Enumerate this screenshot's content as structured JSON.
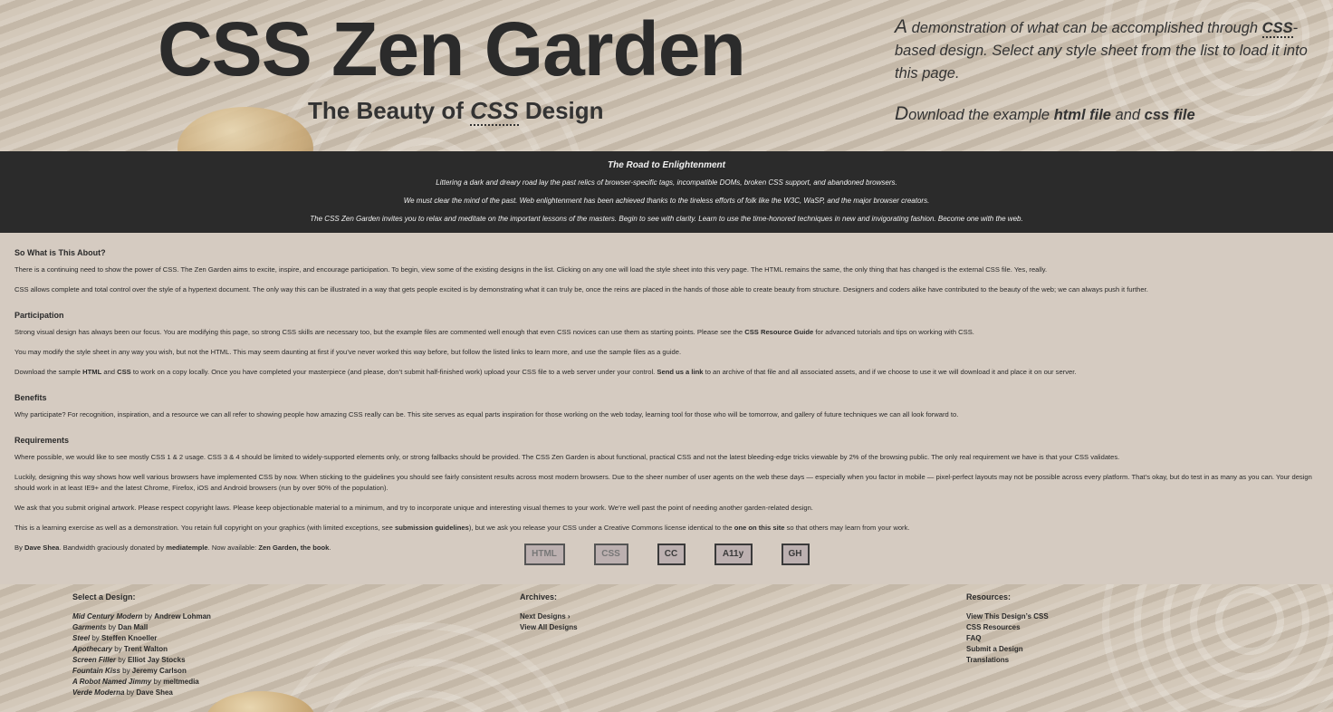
{
  "header": {
    "title": "CSS Zen Garden",
    "tagline_prefix": "The Beauty of ",
    "tagline_abbr": "CSS",
    "tagline_suffix": " Design"
  },
  "summary": {
    "p1_cap": "A",
    "p1_a": " demonstration of what can be accomplished through ",
    "p1_abbr": "CSS",
    "p1_b": "-based design. Select any style sheet from the list to load it into this page.",
    "p2_cap": "D",
    "p2_a": "ownload the example ",
    "p2_html_link": "html file",
    "p2_and": " and ",
    "p2_css_link": "css file"
  },
  "preamble": {
    "heading": "The Road to Enlightenment",
    "p1": "Littering a dark and dreary road lay the past relics of browser-specific tags, incompatible DOMs, broken CSS support, and abandoned browsers.",
    "p2": "We must clear the mind of the past. Web enlightenment has been achieved thanks to the tireless efforts of folk like the W3C, WaSP, and the major browser creators.",
    "p3": "The CSS Zen Garden invites you to relax and meditate on the important lessons of the masters. Begin to see with clarity. Learn to use the time-honored techniques in new and invigorating fashion. Become one with the web."
  },
  "explanation": {
    "heading": "So What is This About?",
    "p1": "There is a continuing need to show the power of CSS. The Zen Garden aims to excite, inspire, and encourage participation. To begin, view some of the existing designs in the list. Clicking on any one will load the style sheet into this very page. The HTML remains the same, the only thing that has changed is the external CSS file. Yes, really.",
    "p2": "CSS allows complete and total control over the style of a hypertext document. The only way this can be illustrated in a way that gets people excited is by demonstrating what it can truly be, once the reins are placed in the hands of those able to create beauty from structure. Designers and coders alike have contributed to the beauty of the web; we can always push it further."
  },
  "participation": {
    "heading": "Participation",
    "p1_a": "Strong visual design has always been our focus. You are modifying this page, so strong CSS skills are necessary too, but the example files are commented well enough that even CSS novices can use them as starting points. Please see the ",
    "p1_link": "CSS Resource Guide",
    "p1_b": " for advanced tutorials and tips on working with CSS.",
    "p2": "You may modify the style sheet in any way you wish, but not the HTML. This may seem daunting at first if you’ve never worked this way before, but follow the listed links to learn more, and use the sample files as a guide.",
    "p3_a": "Download the sample ",
    "p3_html": "HTML",
    "p3_and": " and ",
    "p3_css": "CSS",
    "p3_b": " to work on a copy locally. Once you have completed your masterpiece (and please, don’t submit half-finished work) upload your CSS file to a web server under your control. ",
    "p3_link": "Send us a link",
    "p3_c": " to an archive of that file and all associated assets, and if we choose to use it we will download it and place it on our server."
  },
  "benefits": {
    "heading": "Benefits",
    "p1": "Why participate? For recognition, inspiration, and a resource we can all refer to showing people how amazing CSS really can be. This site serves as equal parts inspiration for those working on the web today, learning tool for those who will be tomorrow, and gallery of future techniques we can all look forward to."
  },
  "requirements": {
    "heading": "Requirements",
    "p1": "Where possible, we would like to see mostly CSS 1 & 2 usage. CSS 3 & 4 should be limited to widely-supported elements only, or strong fallbacks should be provided. The CSS Zen Garden is about functional, practical CSS and not the latest bleeding-edge tricks viewable by 2% of the browsing public. The only real requirement we have is that your CSS validates.",
    "p2": "Luckily, designing this way shows how well various browsers have implemented CSS by now. When sticking to the guidelines you should see fairly consistent results across most modern browsers. Due to the sheer number of user agents on the web these days — especially when you factor in mobile — pixel-perfect layouts may not be possible across every platform. That’s okay, but do test in as many as you can. Your design should work in at least IE9+ and the latest Chrome, Firefox, iOS and Android browsers (run by over 90% of the population).",
    "p3": "We ask that you submit original artwork. Please respect copyright laws. Please keep objectionable material to a minimum, and try to incorporate unique and interesting visual themes to your work. We’re well past the point of needing another garden-related design.",
    "p4_a": "This is a learning exercise as well as a demonstration. You retain full copyright on your graphics (with limited exceptions, see ",
    "p4_link1": "submission guidelines",
    "p4_b": "), but we ask you release your CSS under a Creative Commons license identical to the ",
    "p4_link2": "one on this site",
    "p4_c": " so that others may learn from your work."
  },
  "credits": {
    "by": "By ",
    "author": "Dave Shea",
    "bandwidth": ". Bandwidth graciously donated by ",
    "host": "mediatemple",
    "now": ". Now available: ",
    "book": "Zen Garden, the book",
    "end": "."
  },
  "badges": [
    "HTML",
    "CSS",
    "CC",
    "A11y",
    "GH"
  ],
  "footer": {
    "select_heading": "Select a Design:",
    "designs": [
      {
        "name": "Mid Century Modern",
        "by": " by ",
        "author": "Andrew Lohman"
      },
      {
        "name": "Garments",
        "by": " by ",
        "author": "Dan Mall"
      },
      {
        "name": "Steel",
        "by": " by ",
        "author": "Steffen Knoeller"
      },
      {
        "name": "Apothecary",
        "by": " by ",
        "author": "Trent Walton"
      },
      {
        "name": "Screen Filler",
        "by": " by ",
        "author": "Elliot Jay Stocks"
      },
      {
        "name": "Fountain Kiss",
        "by": " by ",
        "author": "Jeremy Carlson"
      },
      {
        "name": "A Robot Named Jimmy",
        "by": " by ",
        "author": "meltmedia"
      },
      {
        "name": "Verde Moderna",
        "by": " by ",
        "author": "Dave Shea"
      }
    ],
    "archives_heading": "Archives:",
    "archives": [
      "Next Designs ›",
      "View All Designs"
    ],
    "resources_heading": "Resources:",
    "resources": [
      "View This Design’s CSS",
      "CSS Resources",
      "FAQ",
      "Submit a Design",
      "Translations"
    ]
  }
}
